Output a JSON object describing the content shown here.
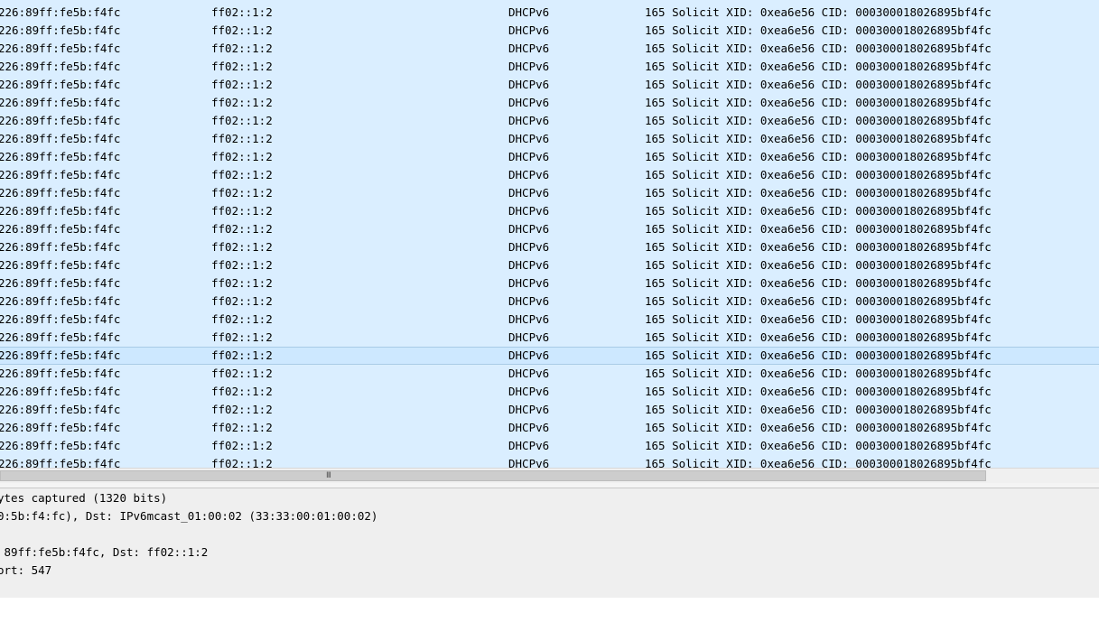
{
  "packet_list": {
    "rows": [
      {
        "src": "226:89ff:fe5b:f4fc",
        "dst": "ff02::1:2",
        "protocol": "DHCPv6",
        "info": "165 Solicit XID: 0xea6e56 CID: 000300018026895bf4fc"
      },
      {
        "src": "226:89ff:fe5b:f4fc",
        "dst": "ff02::1:2",
        "protocol": "DHCPv6",
        "info": "165 Solicit XID: 0xea6e56 CID: 000300018026895bf4fc"
      },
      {
        "src": "226:89ff:fe5b:f4fc",
        "dst": "ff02::1:2",
        "protocol": "DHCPv6",
        "info": "165 Solicit XID: 0xea6e56 CID: 000300018026895bf4fc"
      },
      {
        "src": "226:89ff:fe5b:f4fc",
        "dst": "ff02::1:2",
        "protocol": "DHCPv6",
        "info": "165 Solicit XID: 0xea6e56 CID: 000300018026895bf4fc"
      },
      {
        "src": "226:89ff:fe5b:f4fc",
        "dst": "ff02::1:2",
        "protocol": "DHCPv6",
        "info": "165 Solicit XID: 0xea6e56 CID: 000300018026895bf4fc"
      },
      {
        "src": "226:89ff:fe5b:f4fc",
        "dst": "ff02::1:2",
        "protocol": "DHCPv6",
        "info": "165 Solicit XID: 0xea6e56 CID: 000300018026895bf4fc"
      },
      {
        "src": "226:89ff:fe5b:f4fc",
        "dst": "ff02::1:2",
        "protocol": "DHCPv6",
        "info": "165 Solicit XID: 0xea6e56 CID: 000300018026895bf4fc"
      },
      {
        "src": "226:89ff:fe5b:f4fc",
        "dst": "ff02::1:2",
        "protocol": "DHCPv6",
        "info": "165 Solicit XID: 0xea6e56 CID: 000300018026895bf4fc"
      },
      {
        "src": "226:89ff:fe5b:f4fc",
        "dst": "ff02::1:2",
        "protocol": "DHCPv6",
        "info": "165 Solicit XID: 0xea6e56 CID: 000300018026895bf4fc"
      },
      {
        "src": "226:89ff:fe5b:f4fc",
        "dst": "ff02::1:2",
        "protocol": "DHCPv6",
        "info": "165 Solicit XID: 0xea6e56 CID: 000300018026895bf4fc"
      },
      {
        "src": "226:89ff:fe5b:f4fc",
        "dst": "ff02::1:2",
        "protocol": "DHCPv6",
        "info": "165 Solicit XID: 0xea6e56 CID: 000300018026895bf4fc"
      },
      {
        "src": "226:89ff:fe5b:f4fc",
        "dst": "ff02::1:2",
        "protocol": "DHCPv6",
        "info": "165 Solicit XID: 0xea6e56 CID: 000300018026895bf4fc"
      },
      {
        "src": "226:89ff:fe5b:f4fc",
        "dst": "ff02::1:2",
        "protocol": "DHCPv6",
        "info": "165 Solicit XID: 0xea6e56 CID: 000300018026895bf4fc"
      },
      {
        "src": "226:89ff:fe5b:f4fc",
        "dst": "ff02::1:2",
        "protocol": "DHCPv6",
        "info": "165 Solicit XID: 0xea6e56 CID: 000300018026895bf4fc"
      },
      {
        "src": "226:89ff:fe5b:f4fc",
        "dst": "ff02::1:2",
        "protocol": "DHCPv6",
        "info": "165 Solicit XID: 0xea6e56 CID: 000300018026895bf4fc"
      },
      {
        "src": "226:89ff:fe5b:f4fc",
        "dst": "ff02::1:2",
        "protocol": "DHCPv6",
        "info": "165 Solicit XID: 0xea6e56 CID: 000300018026895bf4fc"
      },
      {
        "src": "226:89ff:fe5b:f4fc",
        "dst": "ff02::1:2",
        "protocol": "DHCPv6",
        "info": "165 Solicit XID: 0xea6e56 CID: 000300018026895bf4fc"
      },
      {
        "src": "226:89ff:fe5b:f4fc",
        "dst": "ff02::1:2",
        "protocol": "DHCPv6",
        "info": "165 Solicit XID: 0xea6e56 CID: 000300018026895bf4fc"
      },
      {
        "src": "226:89ff:fe5b:f4fc",
        "dst": "ff02::1:2",
        "protocol": "DHCPv6",
        "info": "165 Solicit XID: 0xea6e56 CID: 000300018026895bf4fc"
      },
      {
        "src": "226:89ff:fe5b:f4fc",
        "dst": "ff02::1:2",
        "protocol": "DHCPv6",
        "info": "165 Solicit XID: 0xea6e56 CID: 000300018026895bf4fc",
        "selected": true
      },
      {
        "src": "226:89ff:fe5b:f4fc",
        "dst": "ff02::1:2",
        "protocol": "DHCPv6",
        "info": "165 Solicit XID: 0xea6e56 CID: 000300018026895bf4fc"
      },
      {
        "src": "226:89ff:fe5b:f4fc",
        "dst": "ff02::1:2",
        "protocol": "DHCPv6",
        "info": "165 Solicit XID: 0xea6e56 CID: 000300018026895bf4fc"
      },
      {
        "src": "226:89ff:fe5b:f4fc",
        "dst": "ff02::1:2",
        "protocol": "DHCPv6",
        "info": "165 Solicit XID: 0xea6e56 CID: 000300018026895bf4fc"
      },
      {
        "src": "226:89ff:fe5b:f4fc",
        "dst": "ff02::1:2",
        "protocol": "DHCPv6",
        "info": "165 Solicit XID: 0xea6e56 CID: 000300018026895bf4fc"
      },
      {
        "src": "226:89ff:fe5b:f4fc",
        "dst": "ff02::1:2",
        "protocol": "DHCPv6",
        "info": "165 Solicit XID: 0xea6e56 CID: 000300018026895bf4fc"
      },
      {
        "src": "226:89ff:fe5b:f4fc",
        "dst": "ff02::1:2",
        "protocol": "DHCPv6",
        "info": "165 Solicit XID: 0xea6e56 CID: 000300018026895bf4fc"
      }
    ]
  },
  "scrollbar": {
    "grip_glyph": "III"
  },
  "details": {
    "lines": [
      "ytes captured (1320 bits)",
      "0:5b:f4:fc), Dst: IPv6mcast_01:00:02 (33:33:00:01:00:02)",
      "",
      " 89ff:fe5b:f4fc, Dst: ff02::1:2",
      "ort: 547"
    ]
  },
  "colors": {
    "row_background": "#daeeff",
    "selected_row_background": "#cde8ff",
    "details_background": "#efefef",
    "scrollbar_track": "#f0f0f0",
    "scrollbar_thumb": "#cdcdcd"
  },
  "icons": {
    "scrollbar_grip": "grip-lines-icon"
  }
}
